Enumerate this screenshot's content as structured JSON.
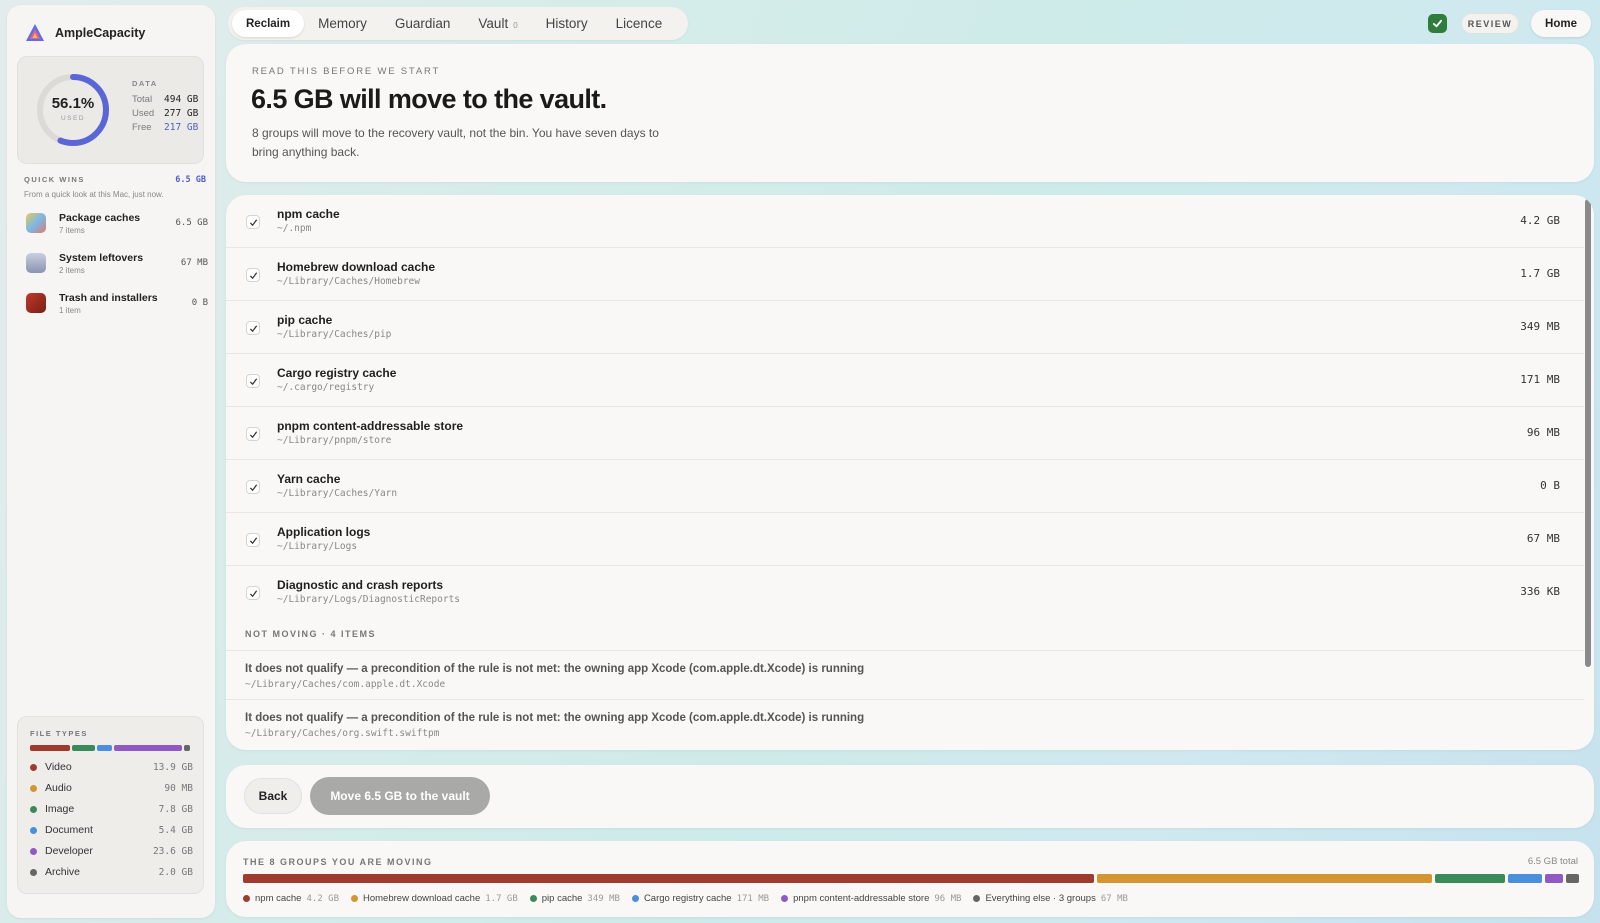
{
  "app": {
    "name": "AmpleCapacity"
  },
  "usage": {
    "percent": "56.1%",
    "percent_value": 56.1,
    "used_label": "USED",
    "data_heading": "DATA",
    "rows": [
      {
        "k": "Total",
        "v": "494 GB"
      },
      {
        "k": "Used",
        "v": "277 GB"
      },
      {
        "k": "Free",
        "v": "217 GB"
      }
    ]
  },
  "quick_wins": {
    "title": "QUICK WINS",
    "amount": "6.5 GB",
    "note": "From a quick look at this Mac, just now.",
    "items": [
      {
        "name": "Package caches",
        "count": "7 items",
        "size": "6.5 GB",
        "icon": "package-icon"
      },
      {
        "name": "System leftovers",
        "count": "2 items",
        "size": "67 MB",
        "icon": "system-icon"
      },
      {
        "name": "Trash and installers",
        "count": "1 item",
        "size": "0 B",
        "icon": "trash-icon"
      }
    ]
  },
  "file_types": {
    "title": "FILE TYPES",
    "items": [
      {
        "label": "Video",
        "value": "13.9 GB",
        "color": "#9e3b2e"
      },
      {
        "label": "Audio",
        "value": "90 MB",
        "color": "#d49633"
      },
      {
        "label": "Image",
        "value": "7.8 GB",
        "color": "#3a8a5c"
      },
      {
        "label": "Document",
        "value": "5.4 GB",
        "color": "#4a8fdc"
      },
      {
        "label": "Developer",
        "value": "23.6 GB",
        "color": "#9059c4"
      },
      {
        "label": "Archive",
        "value": "2.0 GB",
        "color": "#666666"
      }
    ]
  },
  "nav": {
    "tabs": [
      {
        "label": "Reclaim",
        "active": true
      },
      {
        "label": "Memory"
      },
      {
        "label": "Guardian"
      },
      {
        "label": "Vault",
        "badge": "0"
      },
      {
        "label": "History"
      },
      {
        "label": "Licence"
      }
    ],
    "review": "REVIEW",
    "home": "Home"
  },
  "header": {
    "eyebrow": "READ THIS BEFORE WE START",
    "title": "6.5 GB will move to the vault.",
    "subtitle": "8 groups will move to the recovery vault, not the bin. You have seven days to bring anything back."
  },
  "groups": [
    {
      "name": "npm cache",
      "path": "~/.npm",
      "size": "4.2 GB"
    },
    {
      "name": "Homebrew download cache",
      "path": "~/Library/Caches/Homebrew",
      "size": "1.7 GB"
    },
    {
      "name": "pip cache",
      "path": "~/Library/Caches/pip",
      "size": "349 MB"
    },
    {
      "name": "Cargo registry cache",
      "path": "~/.cargo/registry",
      "size": "171 MB"
    },
    {
      "name": "pnpm content-addressable store",
      "path": "~/Library/pnpm/store",
      "size": "96 MB"
    },
    {
      "name": "Yarn cache",
      "path": "~/Library/Caches/Yarn",
      "size": "0 B"
    },
    {
      "name": "Application logs",
      "path": "~/Library/Logs",
      "size": "67 MB"
    },
    {
      "name": "Diagnostic and crash reports",
      "path": "~/Library/Logs/DiagnosticReports",
      "size": "336 KB"
    }
  ],
  "not_moving": {
    "heading": "NOT MOVING · 4 ITEMS",
    "items": [
      {
        "reason": "It does not qualify — a precondition of the rule is not met: the owning app Xcode (com.apple.dt.Xcode) is running",
        "path": "~/Library/Caches/com.apple.dt.Xcode"
      },
      {
        "reason": "It does not qualify — a precondition of the rule is not met: the owning app Xcode (com.apple.dt.Xcode) is running",
        "path": "~/Library/Caches/org.swift.swiftpm"
      }
    ]
  },
  "actions": {
    "back": "Back",
    "move": "Move 6.5 GB to the vault"
  },
  "summary": {
    "title": "THE 8 GROUPS YOU ARE MOVING",
    "total": "6.5 GB total",
    "segments": [
      {
        "label": "npm cache",
        "size": "4.2 GB",
        "fraction": 0.645,
        "color": "#9e3b2e"
      },
      {
        "label": "Homebrew download cache",
        "size": "1.7 GB",
        "fraction": 0.254,
        "color": "#d49633"
      },
      {
        "label": "pip cache",
        "size": "349 MB",
        "fraction": 0.053,
        "color": "#3a8a5c"
      },
      {
        "label": "Cargo registry cache",
        "size": "171 MB",
        "fraction": 0.026,
        "color": "#4a8fdc"
      },
      {
        "label": "pnpm content-addressable store",
        "size": "96 MB",
        "fraction": 0.014,
        "color": "#9059c4"
      },
      {
        "label": "Everything else · 3 groups",
        "size": "67 MB",
        "fraction": 0.01,
        "color": "#666666"
      }
    ]
  }
}
